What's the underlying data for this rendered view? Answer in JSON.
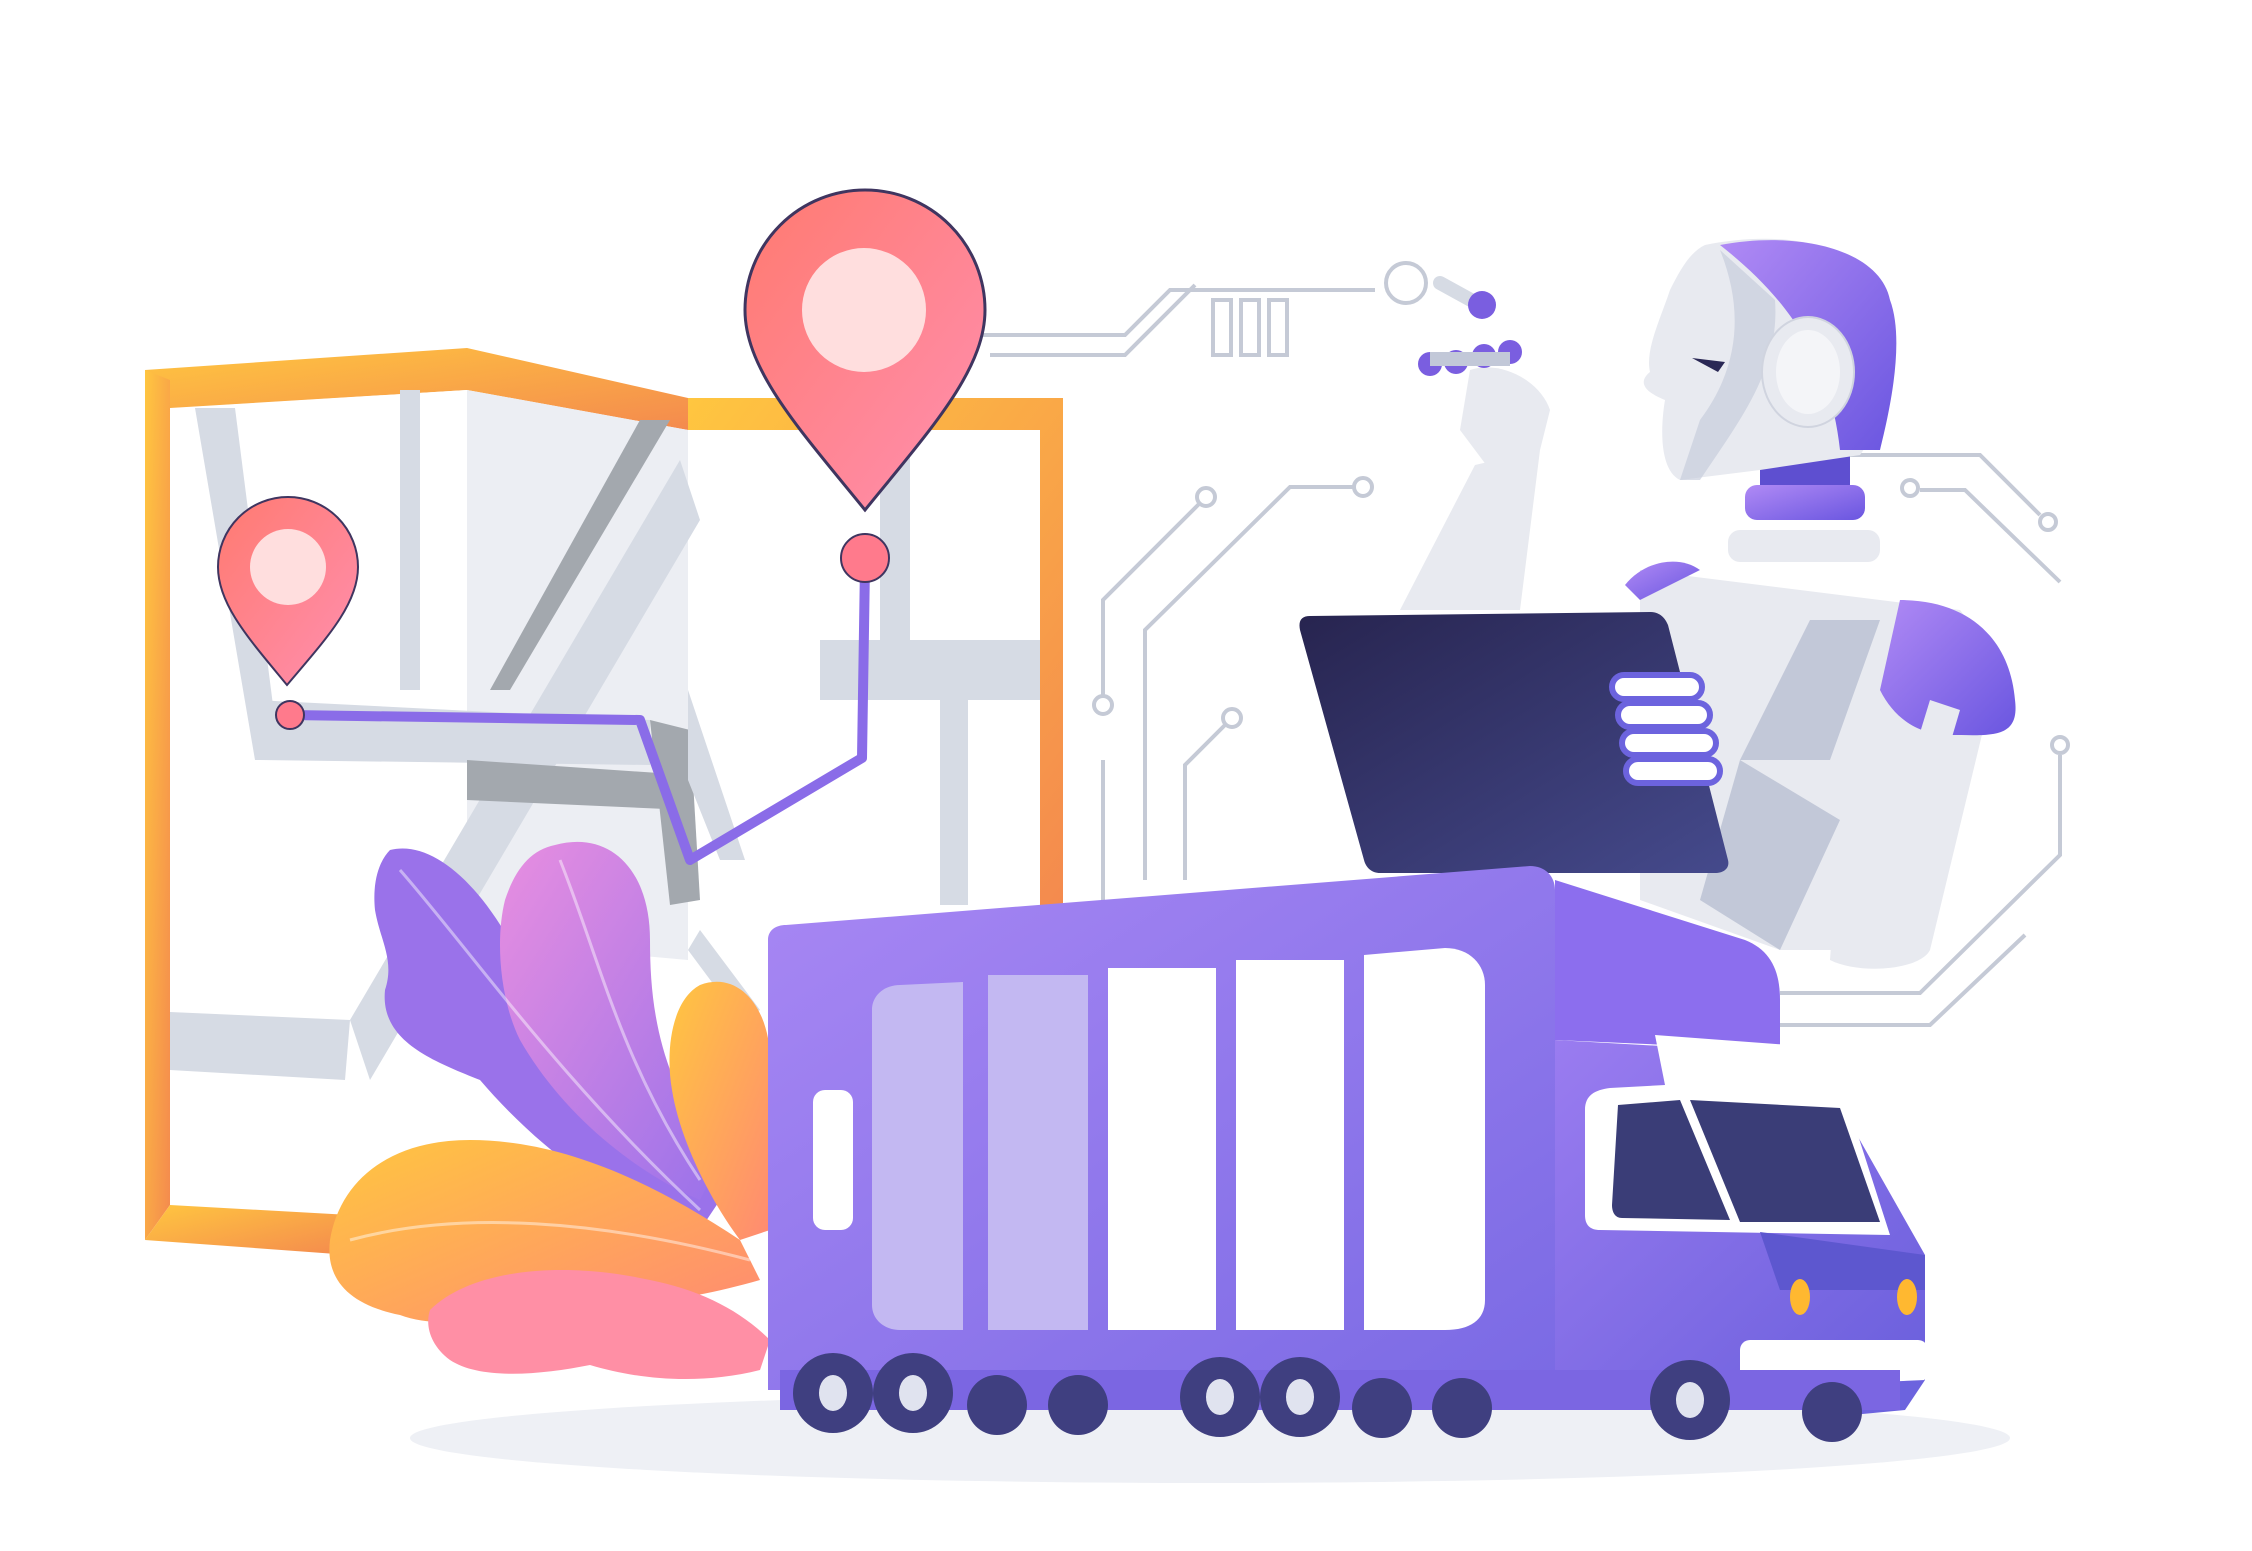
{
  "palette": {
    "background": "#ffffff",
    "map_frame_start": "#ffc640",
    "map_frame_end": "#f48a4e",
    "map_road": "#d6dbe4",
    "map_road_dark": "#a3a8ae",
    "pin_start": "#ff7a70",
    "pin_end": "#ff8fb0",
    "route": "#8a6ce8",
    "circuit": "#c5cad6",
    "truck_light": "#a887f4",
    "truck_dark": "#6c63de",
    "truck_window": "#3a3d77",
    "wheel": "#3f3f80",
    "robot_white": "#e8eaf0",
    "robot_gray": "#c2c8d8",
    "robot_purple": "#8b64e8",
    "tablet_dark": "#2a2855",
    "leaf_purple": "#9a72ea",
    "leaf_pink": "#e88ee0",
    "leaf_orange": "#ffbd45",
    "ground": "#eef0f5"
  },
  "icons": {
    "map": "folded-map-icon",
    "pin_large": "location-pin-icon",
    "pin_small": "location-pin-icon",
    "truck": "delivery-truck-icon",
    "robot": "robot-icon",
    "tablet": "tablet-icon",
    "circuit": "circuit-lines-icon",
    "leaves": "leaves-icon"
  }
}
